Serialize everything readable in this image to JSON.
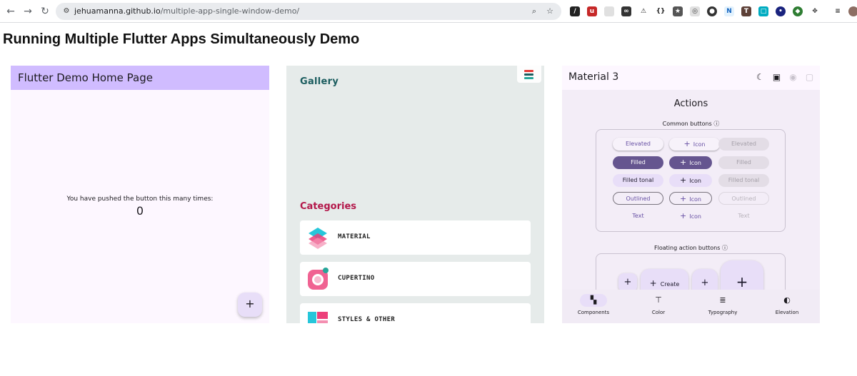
{
  "browser": {
    "url_host": "jehuamanna.github.io",
    "url_path": "/multiple-app-single-window-demo/",
    "back_icon": "back-arrow-icon",
    "forward_icon": "forward-arrow-icon",
    "reload_icon": "reload-icon"
  },
  "page": {
    "title": "Running Multiple Flutter Apps Simultaneously Demo"
  },
  "counter_app": {
    "appbar_title": "Flutter Demo Home Page",
    "message": "You have pushed the button this many times:",
    "count": "0",
    "fab_label": "+",
    "appbar_color": "#d0bcff"
  },
  "gallery_app": {
    "title": "Gallery",
    "categories_heading": "Categories",
    "categories": [
      {
        "label": "MATERIAL",
        "icon": "material-layers-icon"
      },
      {
        "label": "CUPERTINO",
        "icon": "cupertino-camera-icon"
      },
      {
        "label": "STYLES & OTHER",
        "icon": "styles-icon"
      }
    ],
    "title_color": "#1a5c5e",
    "categories_color": "#b3174a"
  },
  "material3_app": {
    "title": "Material 3",
    "section_title": "Actions",
    "common_buttons_label": "Common buttons",
    "fab_section_label": "Floating action buttons",
    "info_glyph": "ⓘ",
    "buttons": {
      "elevated": "Elevated",
      "filled": "Filled",
      "filled_tonal": "Filled tonal",
      "outlined": "Outlined",
      "text": "Text",
      "icon": "Icon",
      "plus": "+"
    },
    "fab_create": "Create",
    "nav": [
      {
        "label": "Components",
        "icon": "widgets-icon",
        "glyph": "▚"
      },
      {
        "label": "Color",
        "icon": "format-paint-icon",
        "glyph": "⊤"
      },
      {
        "label": "Typography",
        "icon": "article-icon",
        "glyph": "≣"
      },
      {
        "label": "Elevation",
        "icon": "contrast-icon",
        "glyph": "◐"
      }
    ],
    "primary_color": "#65558f"
  }
}
